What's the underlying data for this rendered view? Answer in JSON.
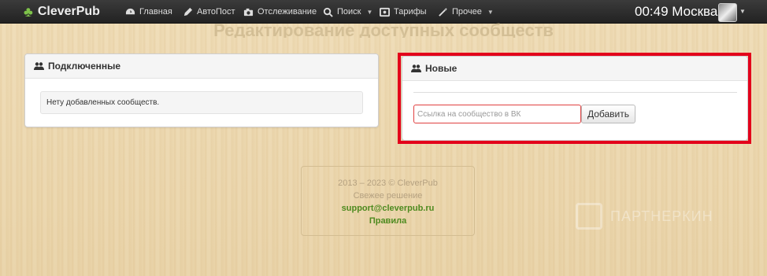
{
  "navbar": {
    "brand": "CleverPub",
    "items": [
      {
        "label": "Главная",
        "icon": "dashboard-icon",
        "dropdown": false
      },
      {
        "label": "АвтоПост",
        "icon": "pencil-icon",
        "dropdown": false
      },
      {
        "label": "Отслеживание",
        "icon": "camera-icon",
        "dropdown": false
      },
      {
        "label": "Поиск",
        "icon": "search-icon",
        "dropdown": true
      },
      {
        "label": "Тарифы",
        "icon": "tariff-icon",
        "dropdown": false
      },
      {
        "label": "Прочее",
        "icon": "magic-wand-icon",
        "dropdown": true
      }
    ],
    "clock": "00:49 Москва"
  },
  "page": {
    "heading": "Редактирование доступных сообществ"
  },
  "connected": {
    "title": "Подключенные",
    "empty_text": "Нету добавленных сообществ."
  },
  "new_panel": {
    "title": "Новые",
    "input_placeholder": "Ссылка на сообщество в ВК",
    "input_value": "",
    "add_label": "Добавить"
  },
  "footer": {
    "copyright": "2013 – 2023 © CleverPub",
    "tagline": "Свежее решение",
    "support_email": "support@cleverpub.ru",
    "rules_link": "Правила"
  },
  "watermark": {
    "text": "ПАРТНЕРКИН"
  },
  "colors": {
    "accent_red": "#e3001b",
    "link_green": "#4d8a1f",
    "navbar_bg": "#2b2b2b"
  }
}
